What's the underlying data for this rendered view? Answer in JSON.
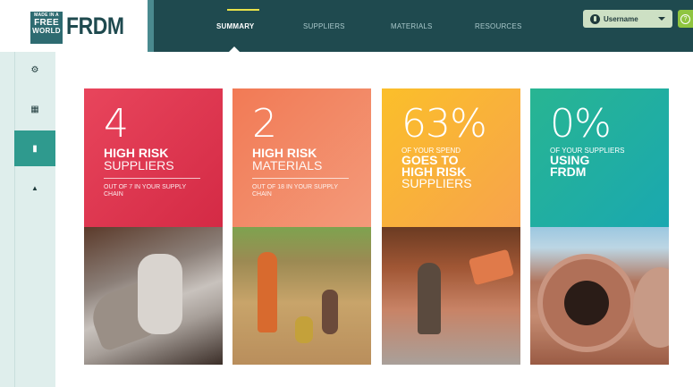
{
  "brand": {
    "badge_line1": "MADE IN A",
    "badge_line2": "FREE",
    "badge_line3": "WORLD",
    "name": "FRDM"
  },
  "nav": {
    "items": [
      {
        "label": "Summary",
        "active": true
      },
      {
        "label": "Suppliers",
        "active": false
      },
      {
        "label": "Materials",
        "active": false
      },
      {
        "label": "Resources",
        "active": false
      }
    ]
  },
  "user": {
    "name": "Username",
    "icon": "user-icon",
    "help_icon": "?"
  },
  "sidebar": {
    "items": [
      {
        "icon": "gear-icon",
        "glyph": "⚙",
        "active": false
      },
      {
        "icon": "grid-icon",
        "glyph": "▦",
        "active": false
      },
      {
        "icon": "chart-icon",
        "glyph": "▮",
        "active": true
      },
      {
        "icon": "bell-icon",
        "glyph": "▲",
        "active": false
      }
    ]
  },
  "cards": [
    {
      "number": "4",
      "title_bold": "High Risk",
      "title_light": "Suppliers",
      "subtitle": "Out of 7 in your supply chain",
      "color": "#d42a45",
      "image": "gloved hands with wire tool"
    },
    {
      "number": "2",
      "title_bold": "High Risk",
      "title_light": "Materials",
      "subtitle": "Out of 18 in your supply chain",
      "color": "#f27a55",
      "image": "women and children working in field"
    },
    {
      "number": "63%",
      "line1": "Of your spend",
      "line2": "goes to",
      "line3": "high risk",
      "line4": "suppliers",
      "color": "#fbbf2a",
      "image": "child carrying bricks"
    },
    {
      "number": "0%",
      "line1": "Of your suppliers",
      "line2": "using",
      "line3": "FRDM",
      "color": "#28b592",
      "image": "steel coils"
    }
  ]
}
